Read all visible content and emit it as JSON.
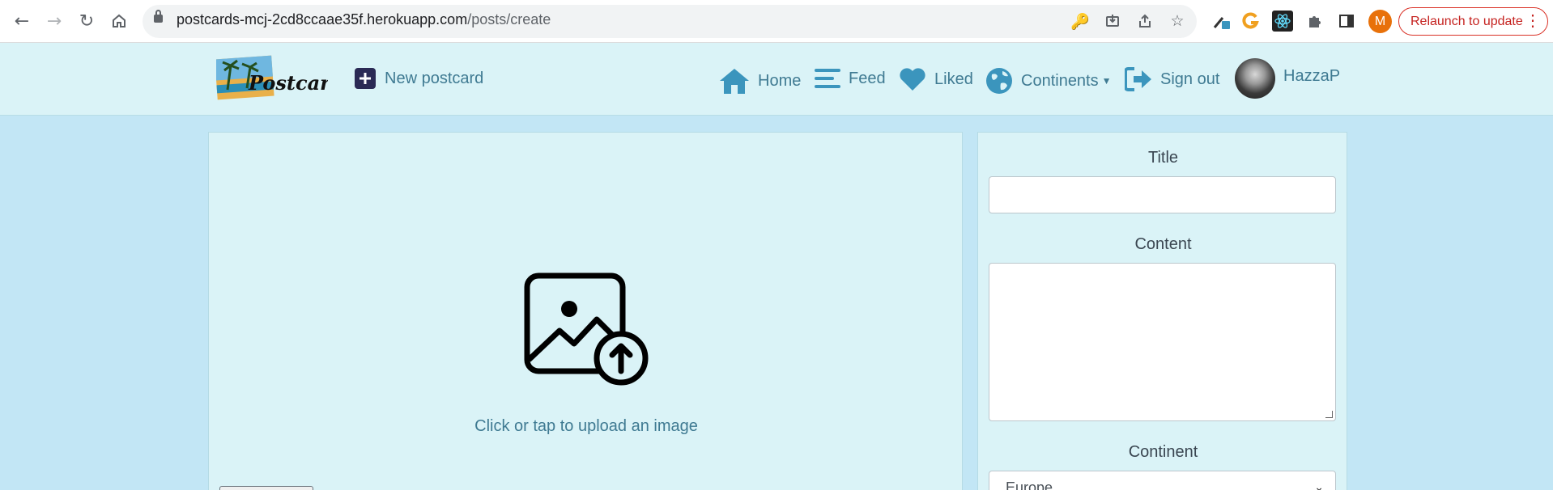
{
  "browser": {
    "url_host": "postcards-mcj-2cd8ccaae35f.herokuapp.com",
    "url_path": "/posts/create",
    "profile_initial": "M",
    "relaunch_label": "Relaunch to update",
    "icons": [
      "back-icon",
      "forward-icon",
      "reload-icon",
      "home-icon",
      "lock-icon",
      "key-icon",
      "install-icon",
      "share-icon",
      "bookmark-star-icon",
      "eyedropper-extension-icon",
      "g-extension-icon",
      "react-extension-icon",
      "puzzle-extensions-icon",
      "side-panel-icon",
      "more-vert-icon"
    ]
  },
  "site_nav": {
    "logo_text": "Postcards",
    "new_postcard": "New postcard",
    "home": "Home",
    "feed": "Feed",
    "liked": "Liked",
    "continents": "Continents",
    "sign_out": "Sign out",
    "username": "HazzaP"
  },
  "upload": {
    "prompt": "Click or tap to upload an image"
  },
  "form": {
    "title_label": "Title",
    "title_value": "",
    "content_label": "Content",
    "content_value": "",
    "continent_label": "Continent",
    "continent_selected": "Europe"
  },
  "colors": {
    "page_bg": "#c2e6f5",
    "panel_bg": "#daf3f7",
    "nav_text": "#3f7a92",
    "nav_icon": "#3b95bd",
    "new_postcard_icon": "#2a2a55"
  }
}
